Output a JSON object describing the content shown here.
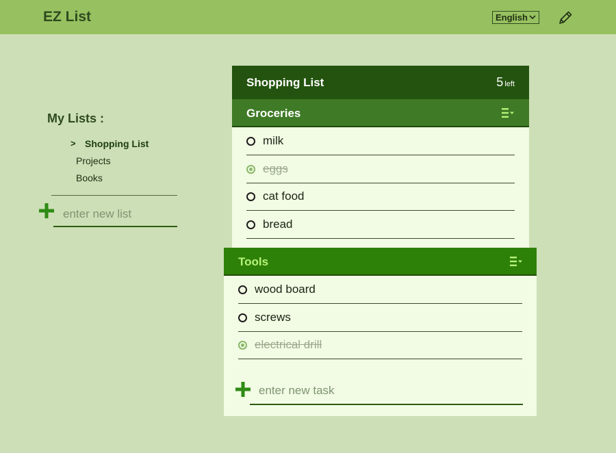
{
  "header": {
    "app_title": "EZ List",
    "language": "English",
    "edit_icon": "pencil-icon"
  },
  "sidebar": {
    "heading": "My Lists :",
    "lists": [
      {
        "label": "Shopping List",
        "active": true,
        "marker": ">"
      },
      {
        "label": "Projects",
        "active": false
      },
      {
        "label": "Books",
        "active": false
      }
    ],
    "new_list_placeholder": "enter new list"
  },
  "main": {
    "list_title": "Shopping List",
    "remaining_count": "5",
    "remaining_label": "left",
    "groups": [
      {
        "title": "Groceries",
        "title_color": "#ffffff",
        "header_color": "#3f7a26",
        "tasks": [
          {
            "text": "milk",
            "done": false
          },
          {
            "text": "eggs",
            "done": true
          },
          {
            "text": "cat food",
            "done": false
          },
          {
            "text": "bread",
            "done": false
          }
        ]
      },
      {
        "title": "Tools",
        "title_color": "#b7f27a",
        "header_color": "#2e8108",
        "tasks": [
          {
            "text": "wood board",
            "done": false
          },
          {
            "text": "screws",
            "done": false
          },
          {
            "text": "electrical drill",
            "done": true
          }
        ]
      }
    ],
    "new_task_placeholder": "enter new task"
  },
  "colors": {
    "background": "#cddfb6",
    "topbar": "#97c160",
    "list_header": "#23530e",
    "accent_green": "#2e8b14",
    "card_background": "#f2fbe4"
  }
}
